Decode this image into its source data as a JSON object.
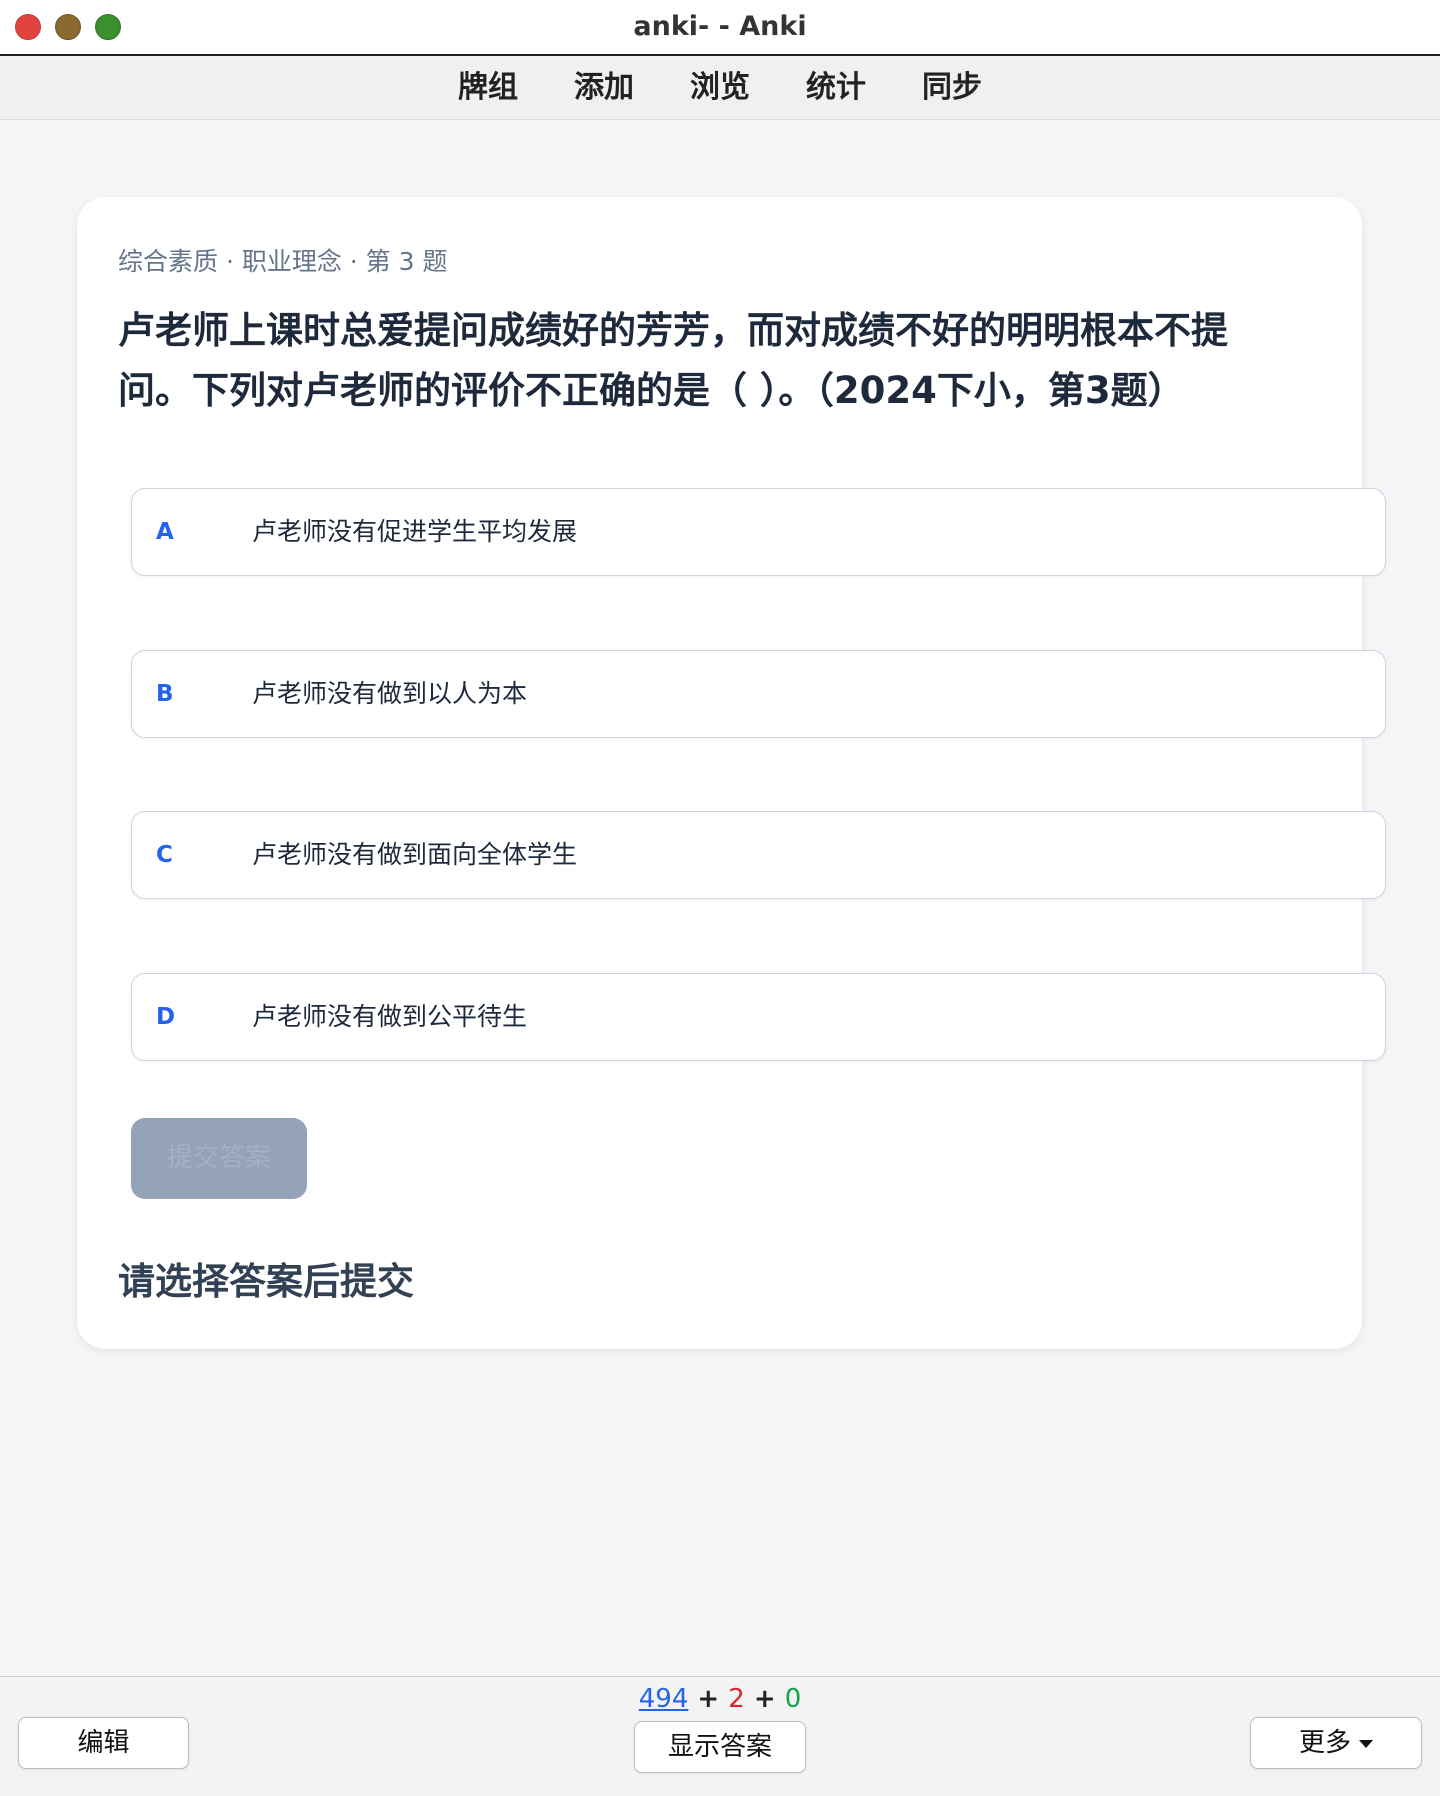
{
  "window": {
    "title": "anki- - Anki"
  },
  "menu": {
    "items": [
      "牌组",
      "添加",
      "浏览",
      "统计",
      "同步"
    ]
  },
  "card": {
    "meta": "综合素质 · 职业理念 · 第 3 题",
    "question": "卢老师上课时总爱提问成绩好的芳芳，而对成绩不好的明明根本不提问。下列对卢老师的评价不正确的是（ ）。（2024下小，第3题）",
    "options": [
      {
        "letter": "A",
        "text": "卢老师没有促进学生平均发展"
      },
      {
        "letter": "B",
        "text": "卢老师没有做到以人为本"
      },
      {
        "letter": "C",
        "text": "卢老师没有做到面向全体学生"
      },
      {
        "letter": "D",
        "text": "卢老师没有做到公平待生"
      }
    ],
    "submit_label": "提交答案",
    "hint": "请选择答案后提交"
  },
  "bottom": {
    "counts": {
      "new": "494",
      "sep1": " + ",
      "learn": "2",
      "sep2": " + ",
      "review": "0"
    },
    "edit_label": "编辑",
    "show_answer_label": "显示答案",
    "more_label": "更多"
  },
  "colors": {
    "accent": "#2563eb",
    "learn": "#dc2626",
    "review": "#16a34a",
    "submit_disabled": "#94a3b8"
  },
  "icons": {
    "more": "chevron-down-icon"
  }
}
